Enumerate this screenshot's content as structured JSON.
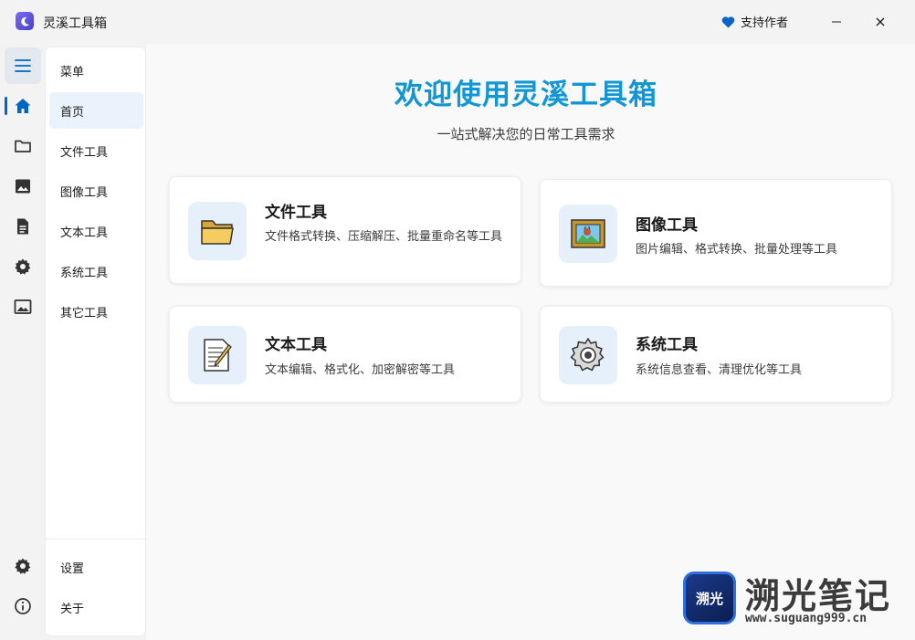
{
  "titlebar": {
    "app_title": "灵溪工具箱",
    "support_label": "支持作者",
    "minimize_glyph": "—",
    "close_glyph": "✕"
  },
  "rail": {
    "icons": [
      "menu-icon",
      "home-icon",
      "folder-icon",
      "image-icon",
      "document-icon",
      "gear-icon",
      "picture-icon",
      "settings-icon",
      "info-icon"
    ]
  },
  "menu": {
    "header": "菜单",
    "items": [
      {
        "label": "首页",
        "active": true
      },
      {
        "label": "文件工具"
      },
      {
        "label": "图像工具"
      },
      {
        "label": "文本工具"
      },
      {
        "label": "系统工具"
      },
      {
        "label": "其它工具"
      }
    ],
    "settings": "设置",
    "about": "关于"
  },
  "main": {
    "welcome": "欢迎使用灵溪工具箱",
    "subtitle": "一站式解决您的日常工具需求",
    "cards": [
      {
        "title": "文件工具",
        "desc": "文件格式转换、压缩解压、批量重命名等工具"
      },
      {
        "title": "图像工具",
        "desc": "图片编辑、格式转换、批量处理等工具"
      },
      {
        "title": "文本工具",
        "desc": "文本编辑、格式化、加密解密等工具"
      },
      {
        "title": "系统工具",
        "desc": "系统信息查看、清理优化等工具"
      }
    ]
  },
  "watermark": {
    "logo_text": "溯光",
    "name": "溯光笔记",
    "url": "www.suguang999.cn"
  },
  "colors": {
    "accent": "#0067c0",
    "title_blue": "#1296d4",
    "heart": "#0a64c8"
  }
}
